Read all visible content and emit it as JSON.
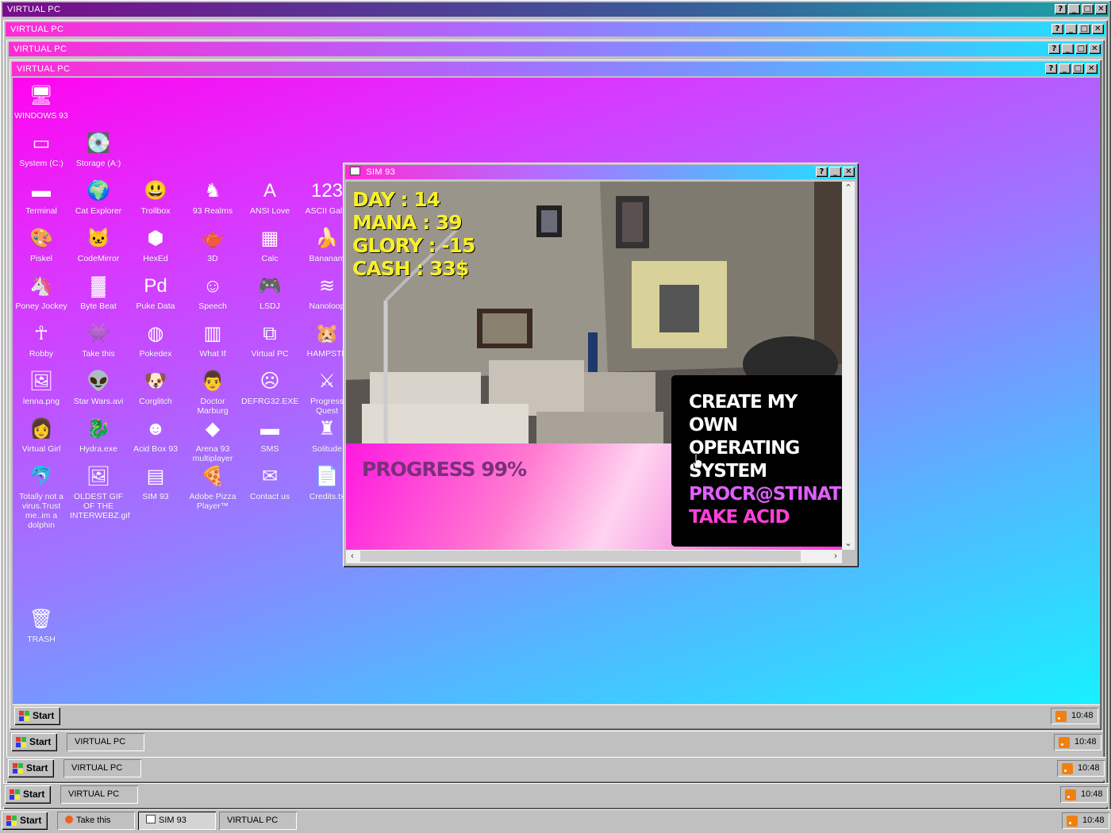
{
  "windows": [
    {
      "title": "VIRTUAL PC"
    },
    {
      "title": "VIRTUAL PC"
    },
    {
      "title": "VIRTUAL PC"
    },
    {
      "title": "VIRTUAL PC"
    }
  ],
  "title_buttons": {
    "help": "?",
    "minimize": "_",
    "maximize": "□",
    "close": "✕"
  },
  "desktop_icons": [
    {
      "label": "WINDOWS 93",
      "icon": "computer-icon",
      "glyph": "🖥"
    },
    {
      "label": "System (C:)",
      "icon": "drive-icon",
      "glyph": "▭"
    },
    {
      "label": "Storage (A:)",
      "icon": "floppy-drive-icon",
      "glyph": "💽"
    },
    {
      "label": "Terminal",
      "icon": "terminal-icon",
      "glyph": "▬"
    },
    {
      "label": "Cat Explorer",
      "icon": "globe-icon",
      "glyph": "🌍"
    },
    {
      "label": "Trollbox",
      "icon": "smiley-chat-icon",
      "glyph": "😃"
    },
    {
      "label": "93 Realms",
      "icon": "knight-icon",
      "glyph": "♞"
    },
    {
      "label": "ANSI Love",
      "icon": "letter-a-icon",
      "glyph": "A"
    },
    {
      "label": "ASCII Galle",
      "icon": "numbers-icon",
      "glyph": "123"
    },
    {
      "label": "Piskel",
      "icon": "palette-icon",
      "glyph": "🎨"
    },
    {
      "label": "CodeMirror",
      "icon": "cat-icon",
      "glyph": "🐱"
    },
    {
      "label": "HexEd",
      "icon": "cube-icon",
      "glyph": "⬢"
    },
    {
      "label": "3D",
      "icon": "teapot-icon",
      "glyph": "🫖"
    },
    {
      "label": "Calc",
      "icon": "calculator-icon",
      "glyph": "▦"
    },
    {
      "label": "Bananam",
      "icon": "banana-icon",
      "glyph": "🍌"
    },
    {
      "label": "Poney Jockey",
      "icon": "pony-icon",
      "glyph": "🦄"
    },
    {
      "label": "Byte Beat",
      "icon": "bytebeat-icon",
      "glyph": "▓"
    },
    {
      "label": "Puke Data",
      "icon": "pd-icon",
      "glyph": "Pd"
    },
    {
      "label": "Speech",
      "icon": "speech-face-icon",
      "glyph": "☺"
    },
    {
      "label": "LSDJ",
      "icon": "gameboy-icon",
      "glyph": "🎮"
    },
    {
      "label": "Nanoloop",
      "icon": "wave-icon",
      "glyph": "≋"
    },
    {
      "label": "Robby",
      "icon": "stick-figure-icon",
      "glyph": "☥"
    },
    {
      "label": "Take this",
      "icon": "mario-icon",
      "glyph": "👾"
    },
    {
      "label": "Pokedex",
      "icon": "pokeball-icon",
      "glyph": "◍"
    },
    {
      "label": "What If",
      "icon": "whatif-icon",
      "glyph": "▥"
    },
    {
      "label": "Virtual PC",
      "icon": "virtual-pc-icon",
      "glyph": "⧉"
    },
    {
      "label": "HAMPSTE",
      "icon": "hamster-icon",
      "glyph": "🐹"
    },
    {
      "label": "lenna.png",
      "icon": "image-file-icon",
      "glyph": "🖼"
    },
    {
      "label": "Star Wars.avi",
      "icon": "yoda-icon",
      "glyph": "👽"
    },
    {
      "label": "Corglitch",
      "icon": "corgi-icon",
      "glyph": "🐶"
    },
    {
      "label": "Doctor Marburg",
      "icon": "doctor-icon",
      "glyph": "👨"
    },
    {
      "label": "DEFRG32.EXE",
      "icon": "defrag-icon",
      "glyph": "☹"
    },
    {
      "label": "Progress Quest",
      "icon": "crossed-swords-icon",
      "glyph": "⚔"
    },
    {
      "label": "Virtual Girl",
      "icon": "girl-icon",
      "glyph": "👩"
    },
    {
      "label": "Hydra.exe",
      "icon": "hydra-icon",
      "glyph": "🐉"
    },
    {
      "label": "Acid Box 93",
      "icon": "acid-smiley-icon",
      "glyph": "☻"
    },
    {
      "label": "Arena 93 multiplayer",
      "icon": "arena-cube-icon",
      "glyph": "◆"
    },
    {
      "label": "SMS",
      "icon": "sms-icon",
      "glyph": "▬"
    },
    {
      "label": "Solitude",
      "icon": "solitude-icon",
      "glyph": "♜"
    },
    {
      "label": "Totally not a virus.Trust me..im a dolphin",
      "icon": "dolphin-icon",
      "glyph": "🐬"
    },
    {
      "label": "OLDEST GIF OF THE INTERWEBZ.gif",
      "icon": "gif-file-icon",
      "glyph": "🖼"
    },
    {
      "label": "SIM 93",
      "icon": "sim93-icon",
      "glyph": "▤"
    },
    {
      "label": "Adobe Pizza Player™",
      "icon": "pizza-icon",
      "glyph": "🍕"
    },
    {
      "label": "Contact us",
      "icon": "contact-icon",
      "glyph": "✉"
    },
    {
      "label": "Credits.tx",
      "icon": "text-file-icon",
      "glyph": "📄"
    },
    {
      "label": "TRASH",
      "icon": "trash-icon",
      "glyph": "🗑"
    }
  ],
  "sim93": {
    "title": "SIM 93",
    "stats": [
      "DAY : 14",
      "MANA : 39",
      "GLORY : -15",
      "CASH : 33$"
    ],
    "progress": "PROGRESS 99%",
    "options": [
      "CREATE MY OWN OPERATING SYSTEM",
      "PROCR@STINATION",
      "TAKE ACID"
    ],
    "colors": {
      "stats": "#f8f028",
      "option_procrastination": "#e060ff",
      "option_acid": "#ff40d8"
    }
  },
  "taskbars": [
    {
      "start": "Start",
      "tabs": [],
      "time": "10:48"
    },
    {
      "start": "Start",
      "tabs": [
        "VIRTUAL PC"
      ],
      "time": "10:48"
    },
    {
      "start": "Start",
      "tabs": [
        "VIRTUAL PC"
      ],
      "time": "10:48"
    },
    {
      "start": "Start",
      "tabs": [
        "VIRTUAL PC"
      ],
      "time": "10:48"
    },
    {
      "start": "Start",
      "tabs": [
        "Take this",
        "SIM 93",
        "VIRTUAL PC"
      ],
      "time": "10:48"
    }
  ]
}
